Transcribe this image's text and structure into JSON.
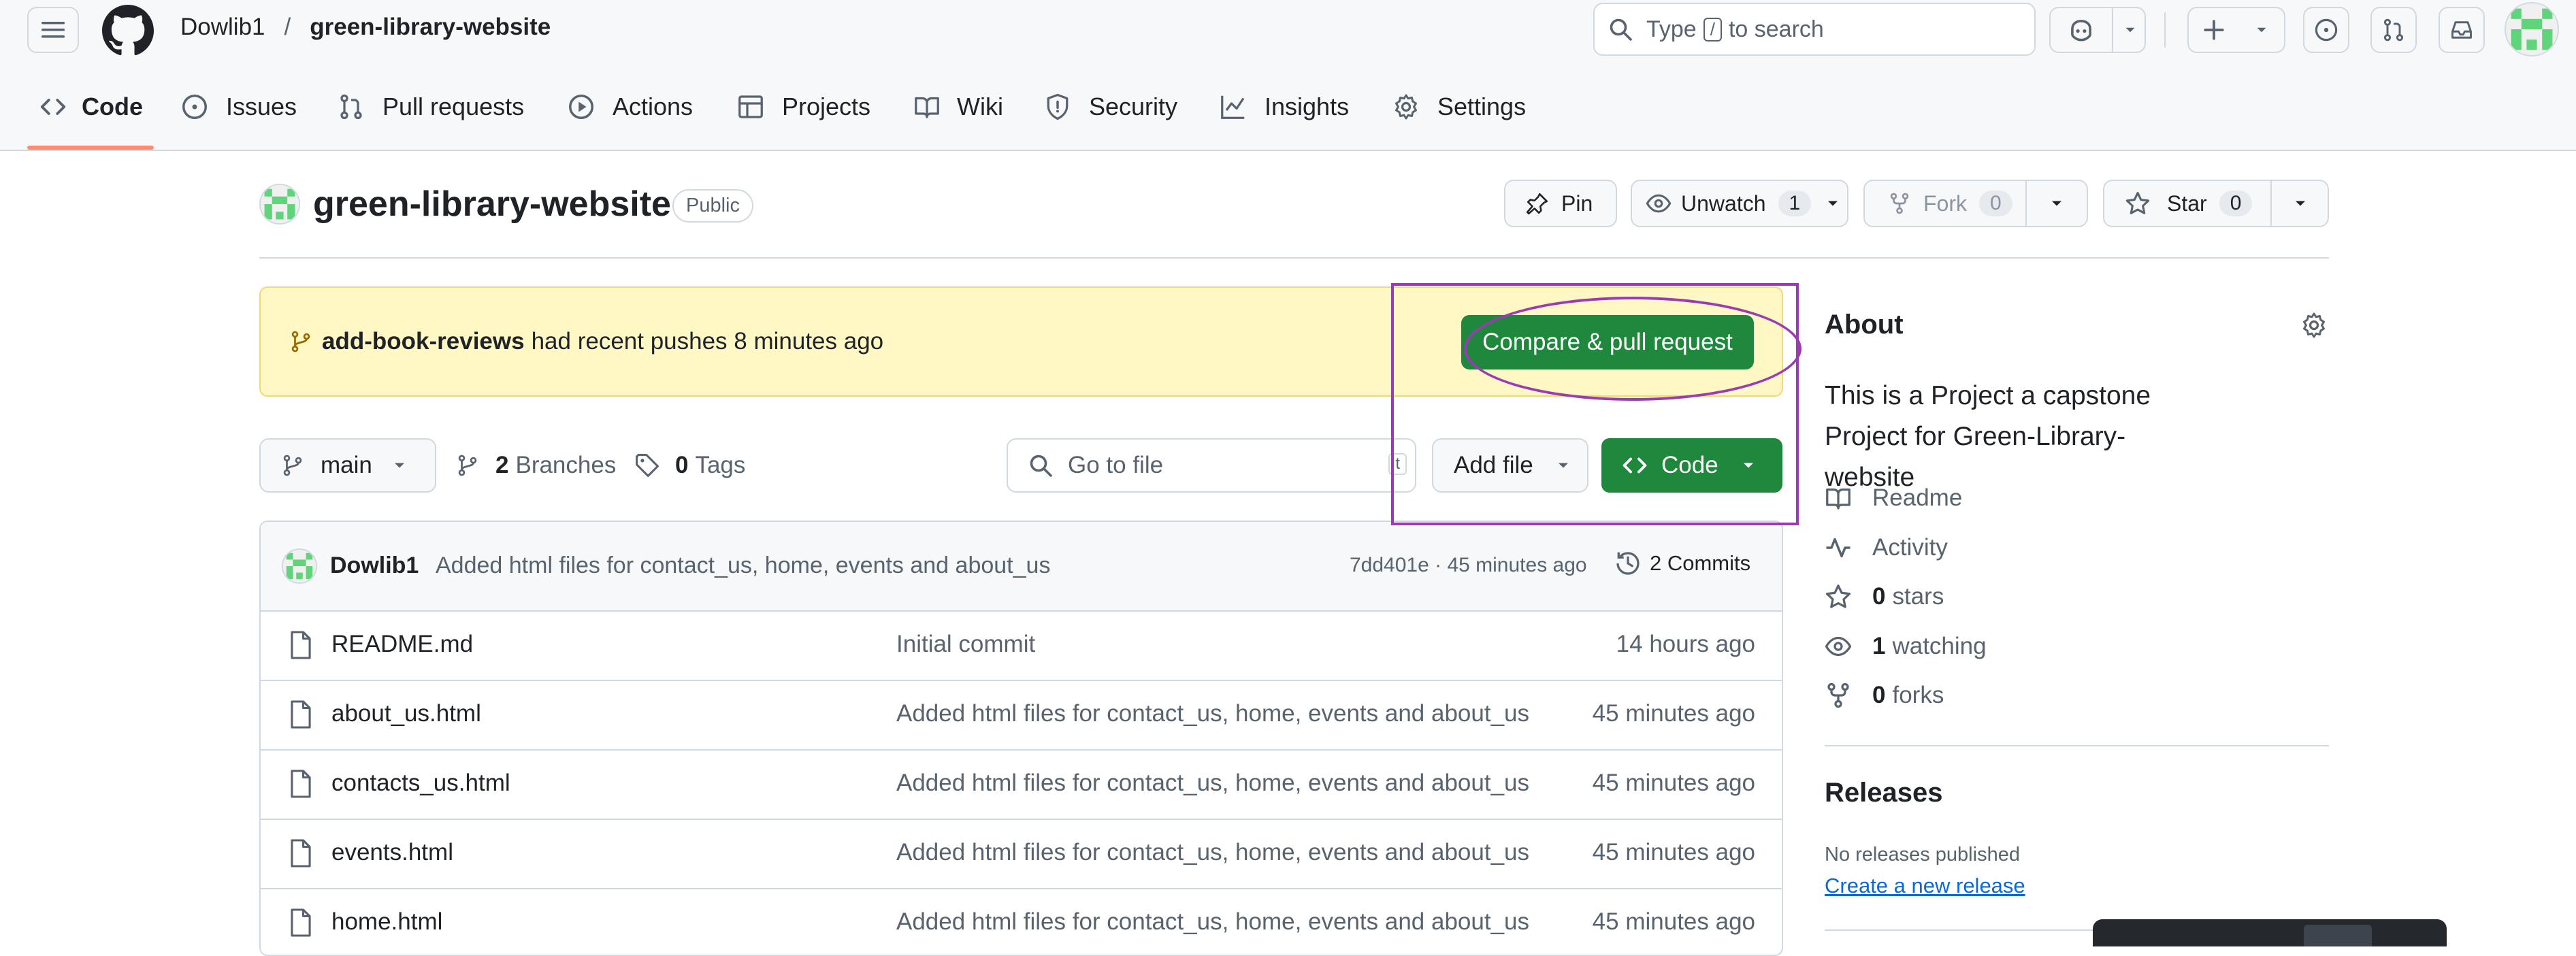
{
  "header": {
    "owner": "Dowlib1",
    "separator": "/",
    "repo": "green-library-website",
    "search_prefix": "Type",
    "search_key": "/",
    "search_suffix": "to search"
  },
  "tabs": [
    {
      "label": "Code",
      "icon": "code-icon"
    },
    {
      "label": "Issues",
      "icon": "issue-opened-icon"
    },
    {
      "label": "Pull requests",
      "icon": "git-pull-request-icon"
    },
    {
      "label": "Actions",
      "icon": "play-icon"
    },
    {
      "label": "Projects",
      "icon": "table-icon"
    },
    {
      "label": "Wiki",
      "icon": "book-icon"
    },
    {
      "label": "Security",
      "icon": "shield-icon"
    },
    {
      "label": "Insights",
      "icon": "graph-icon"
    },
    {
      "label": "Settings",
      "icon": "gear-icon"
    }
  ],
  "repo_header": {
    "name": "green-library-website",
    "visibility": "Public",
    "pin": "Pin",
    "unwatch": "Unwatch",
    "watch_count": "1",
    "fork": "Fork",
    "fork_count": "0",
    "star": "Star",
    "star_count": "0"
  },
  "banner": {
    "branch": "add-book-reviews",
    "text": "had recent pushes 8 minutes ago",
    "button": "Compare & pull request"
  },
  "toolbar": {
    "branch": "main",
    "branches_count": "2",
    "branches_label": "Branches",
    "tags_count": "0",
    "tags_label": "Tags",
    "go_to_file": "Go to file",
    "go_to_file_key": "t",
    "add_file": "Add file",
    "code": "Code"
  },
  "commit": {
    "author": "Dowlib1",
    "message": "Added html files for contact_us, home, events and about_us",
    "sha_time": "7dd401e · 45 minutes ago",
    "commits": "2 Commits"
  },
  "files": [
    {
      "name": "README.md",
      "message": "Initial commit",
      "time": "14 hours ago"
    },
    {
      "name": "about_us.html",
      "message": "Added html files for contact_us, home, events and about_us",
      "time": "45 minutes ago"
    },
    {
      "name": "contacts_us.html",
      "message": "Added html files for contact_us, home, events and about_us",
      "time": "45 minutes ago"
    },
    {
      "name": "events.html",
      "message": "Added html files for contact_us, home, events and about_us",
      "time": "45 minutes ago"
    },
    {
      "name": "home.html",
      "message": "Added html files for contact_us, home, events and about_us",
      "time": "45 minutes ago"
    }
  ],
  "about": {
    "title": "About",
    "description": "This is a Project a capstone Project for Green-Library-website",
    "readme": "Readme",
    "activity": "Activity",
    "stars_count": "0",
    "stars_label": "stars",
    "watching_count": "1",
    "watching_label": "watching",
    "forks_count": "0",
    "forks_label": "forks"
  },
  "releases": {
    "title": "Releases",
    "none": "No releases published",
    "create": "Create a new release"
  },
  "colors": {
    "accent_green": "#1f883d",
    "banner_bg": "#fff8c5",
    "annotation": "#9b3bb3",
    "tab_underline": "#fd8c73"
  }
}
